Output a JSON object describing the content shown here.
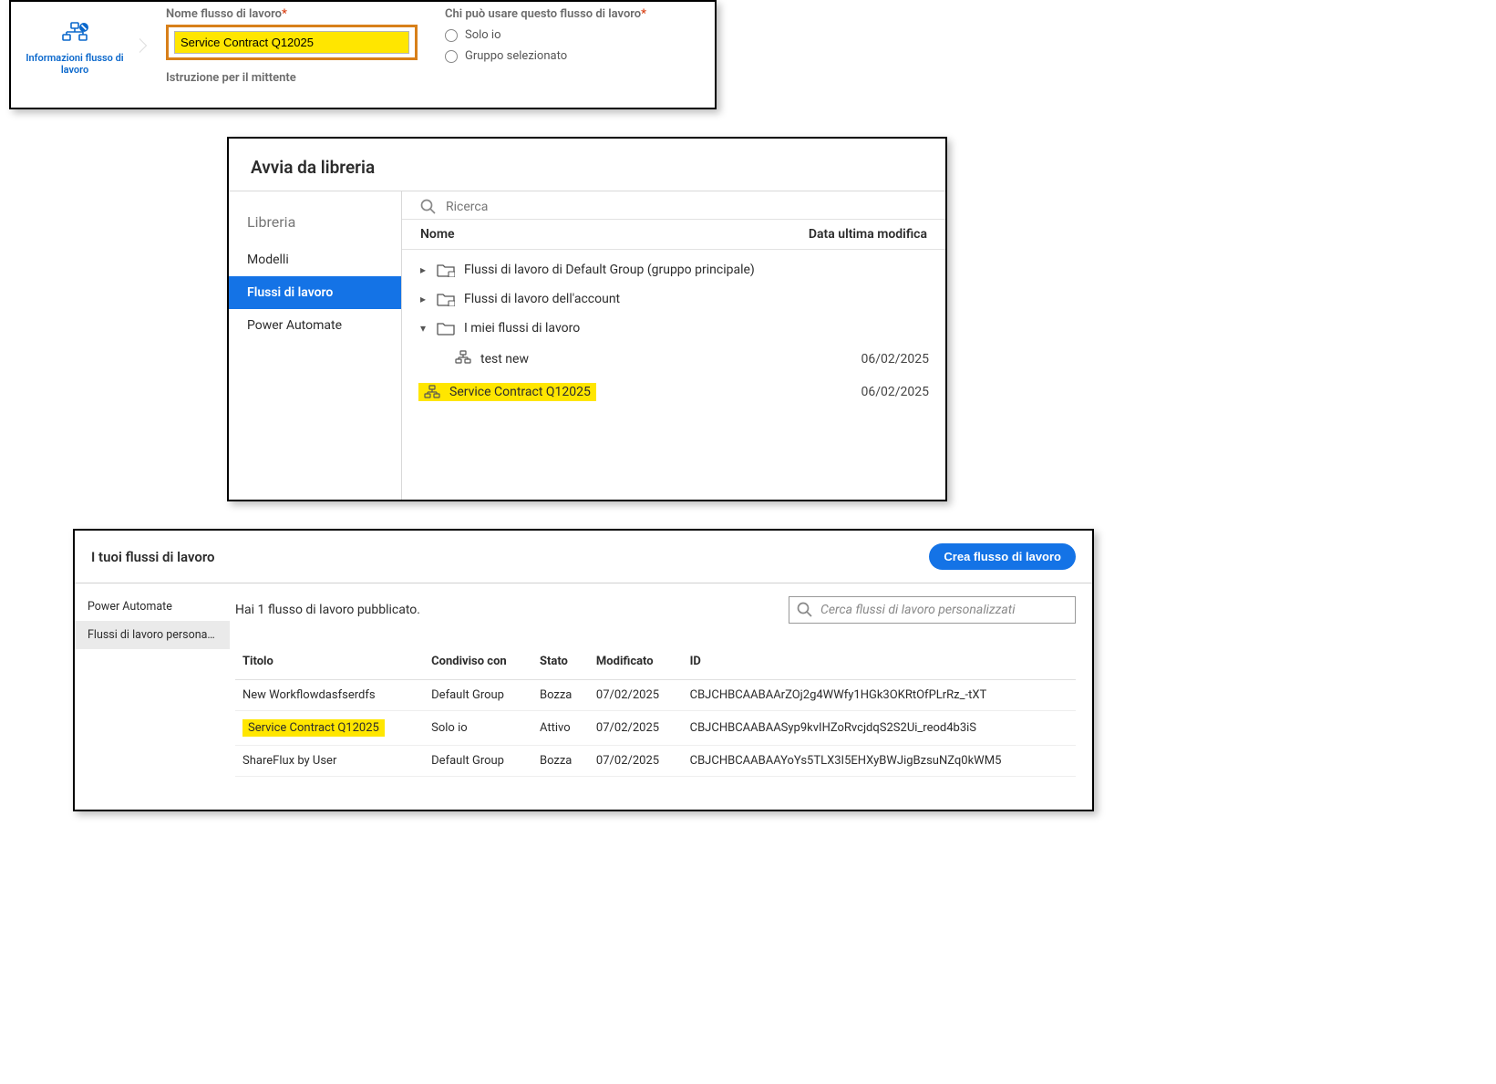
{
  "panel1": {
    "side_label_line1": "Informazioni flusso di",
    "side_label_line2": "lavoro",
    "name_label": "Nome flusso di lavoro",
    "name_value": "Service Contract Q12025",
    "who_label": "Chi può usare questo flusso di lavoro",
    "radio_only_me": "Solo io",
    "radio_group": "Gruppo selezionato",
    "sender_label": "Istruzione per il mittente"
  },
  "panel2": {
    "title": "Avvia da libreria",
    "side_title": "Libreria",
    "side_items": [
      "Modelli",
      "Flussi di lavoro",
      "Power Automate"
    ],
    "search_placeholder": "Ricerca",
    "col_name": "Nome",
    "col_date": "Data ultima modifica",
    "rows": {
      "r0": "Flussi di lavoro di Default Group (gruppo principale)",
      "r1": "Flussi di lavoro dell'account",
      "r2": "I miei flussi di lavoro",
      "leaf0_name": "test new",
      "leaf0_date": "06/02/2025",
      "leaf1_name": "Service Contract Q12025",
      "leaf1_date": "06/02/2025"
    }
  },
  "panel3": {
    "title": "I tuoi flussi di lavoro",
    "create_btn": "Crea flusso di lavoro",
    "side_items": [
      "Power Automate",
      "Flussi di lavoro personaliz…"
    ],
    "published_msg": "Hai 1 flusso di lavoro pubblicato.",
    "search_placeholder": "Cerca flussi di lavoro personalizzati",
    "cols": {
      "title": "Titolo",
      "shared": "Condiviso con",
      "state": "Stato",
      "modified": "Modificato",
      "id": "ID"
    },
    "rows": [
      {
        "title": "New Workflowdasfserdfs",
        "shared": "Default Group",
        "state": "Bozza",
        "modified": "07/02/2025",
        "id": "CBJCHBCAABAArZOj2g4WWfy1HGk3OKRtOfPLrRz_-tXT",
        "hl": false
      },
      {
        "title": "Service Contract Q12025",
        "shared": "Solo io",
        "state": "Attivo",
        "modified": "07/02/2025",
        "id": "CBJCHBCAABAASyp9kvIHZoRvcjdqS2S2Ui_reod4b3iS",
        "hl": true
      },
      {
        "title": "ShareFlux by User",
        "shared": "Default Group",
        "state": "Bozza",
        "modified": "07/02/2025",
        "id": "CBJCHBCAABAAYoYs5TLX3I5EHXyBWJigBzsuNZq0kWM5",
        "hl": false
      }
    ]
  }
}
